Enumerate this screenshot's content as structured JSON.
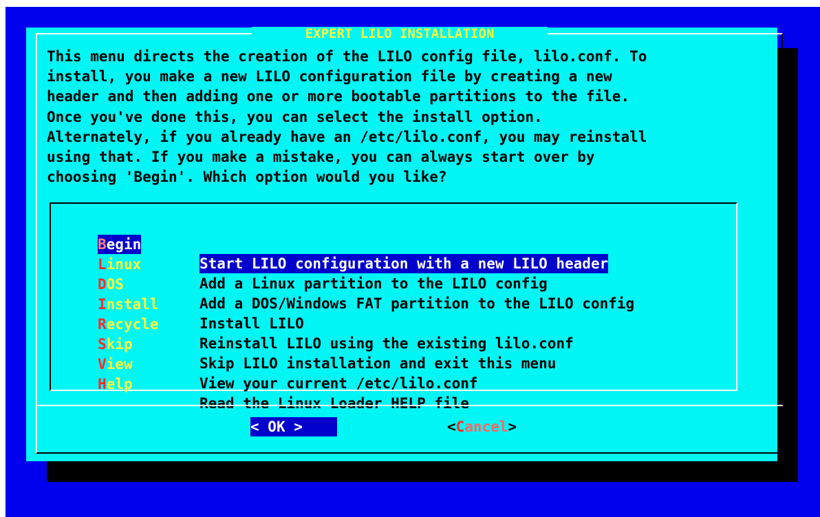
{
  "dialog": {
    "title": "EXPERT LILO INSTALLATION",
    "description": [
      "This menu directs the creation of the LILO config file, lilo.conf. To",
      "install, you make a new LILO configuration file by creating a new",
      "header and then adding one or more bootable partitions to the file.",
      "Once you've done this, you can select the install option.",
      "Alternately, if you already have an /etc/lilo.conf, you may reinstall",
      "using that. If you make a mistake, you can always start over by",
      "choosing 'Begin'. Which option would you like?"
    ]
  },
  "menu": {
    "selected_index": 0,
    "items": [
      {
        "tag_hot": "B",
        "tag_rest": "egin",
        "description": "Start LILO configuration with a new LILO header"
      },
      {
        "tag_hot": "L",
        "tag_rest": "inux",
        "description": "Add a Linux partition to the LILO config"
      },
      {
        "tag_hot": "D",
        "tag_rest": "OS",
        "description": "Add a DOS/Windows FAT partition to the LILO config"
      },
      {
        "tag_hot": "I",
        "tag_rest": "nstall",
        "description": "Install LILO"
      },
      {
        "tag_hot": "R",
        "tag_rest": "ecycle",
        "description": "Reinstall LILO using the existing lilo.conf"
      },
      {
        "tag_hot": "S",
        "tag_rest": "kip",
        "description": "Skip LILO installation and exit this menu"
      },
      {
        "tag_hot": "V",
        "tag_rest": "iew",
        "description": "View your current /etc/lilo.conf"
      },
      {
        "tag_hot": "H",
        "tag_rest": "elp",
        "description": "Read the Linux Loader HELP file"
      }
    ]
  },
  "buttons": {
    "ok": {
      "open": "< ",
      "label": "OK",
      "close": " >"
    },
    "cancel": {
      "open": "<",
      "hot": "C",
      "rest": "ancel",
      "close": ">"
    }
  },
  "colors": {
    "screen_bg": "#0000ee",
    "dialog_bg": "#00f5f5",
    "title_fg": "#ffff3a",
    "hotkey_fg": "#ff2a2a",
    "selection_bg": "#0000cc"
  }
}
